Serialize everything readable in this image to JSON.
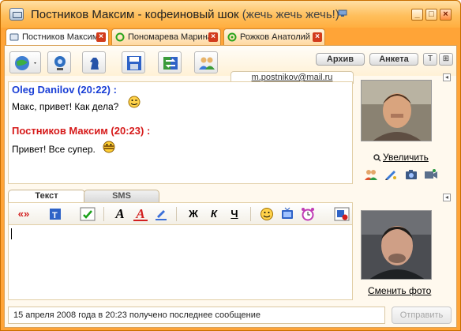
{
  "window": {
    "title_name": "Постников Максим - кофеиновый шок",
    "title_status": "(жечь жечь жечь!)",
    "minimize": "_",
    "maximize": "□",
    "close": "×"
  },
  "tabs": [
    {
      "label": "Постников Максим",
      "active": true
    },
    {
      "label": "Пономарева Марина",
      "active": false
    },
    {
      "label": "Рожков Анатолий",
      "active": false
    }
  ],
  "tab_close_glyph": "×",
  "toolbar": {
    "archive_label": "Архив",
    "profile_label": "Анкета",
    "sq1_glyph": "T",
    "sq2_glyph": "⊞"
  },
  "contact_email": "m.postnikov@mail.ru",
  "messages": [
    {
      "header": "Oleg Danilov (20:22) :",
      "text": "Макс, привет! Как дела?"
    },
    {
      "header": "Постников Максим (20:23) :",
      "text": "Привет! Все супер."
    }
  ],
  "contact_panel": {
    "zoom_link": "Увеличить",
    "change_photo_link": "Сменить фото"
  },
  "compose": {
    "tab_text": "Текст",
    "tab_sms": "SMS",
    "quote_glyph": "«»",
    "bold_glyph": "Ж",
    "italic_glyph": "К",
    "underline_glyph": "Ч",
    "font_glyph": "A",
    "color_glyph": "A"
  },
  "status_bar": {
    "text": "15 апреля 2008 года в 20:23 получено последнее сообщение"
  },
  "send_button": "Отправить",
  "colors": {
    "frame": "#ffa437",
    "sender_self": "#1a3fd6",
    "sender_other": "#d61a1a"
  }
}
